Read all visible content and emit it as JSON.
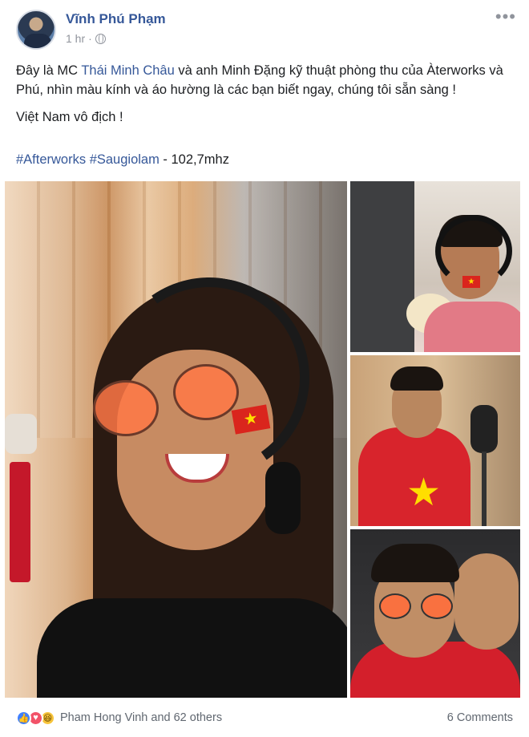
{
  "post": {
    "author": "Vĩnh Phú Phạm",
    "time": "1 hr",
    "separator": "·",
    "more_icon": "more-horizontal-icon",
    "privacy_icon": "globe-icon"
  },
  "content": {
    "line1_pre": "Đây là MC ",
    "mention": "Thái Minh Châu",
    "line1_post": " và anh Minh Đặng kỹ thuật phòng thu của Àterworks và Phú, nhìn màu kính và áo hường là các bạn biết ngay, chúng tôi sẵn sàng !",
    "line2": "Việt Nam vô địch !",
    "hashtag1": "#Afterworks",
    "hashtag2": "#Saugiolam",
    "tag_suffix": " - 102,7mhz"
  },
  "photos": {
    "count": 4,
    "flag_star": "★"
  },
  "footer": {
    "reactions_text": "Pham Hong Vinh and 62 others",
    "comments": "6 Comments",
    "reaction_icons": [
      "like-icon",
      "love-icon",
      "haha-icon"
    ]
  },
  "colors": {
    "link": "#365899",
    "text": "#1c1e21",
    "meta": "#90949c",
    "like": "#4080ff",
    "love": "#f25268",
    "haha": "#f7c43b"
  }
}
